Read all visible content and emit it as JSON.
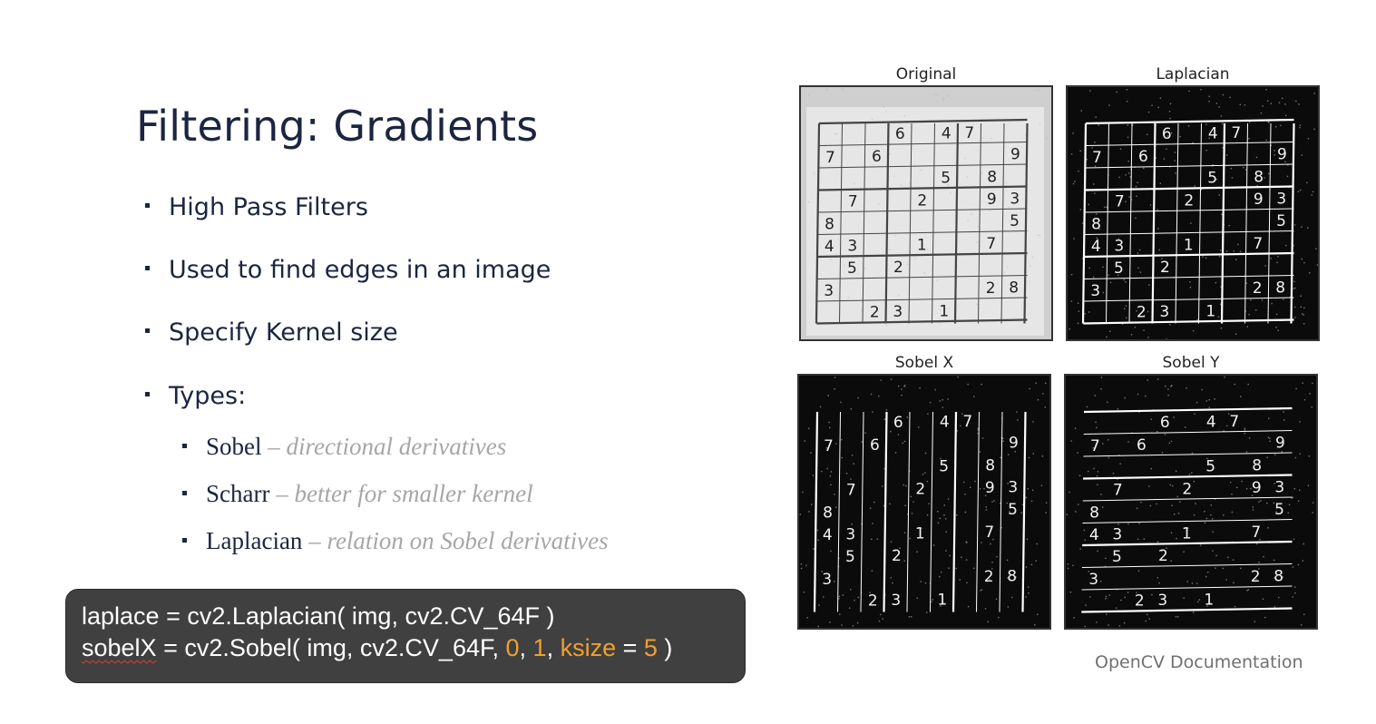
{
  "slide": {
    "title": "Filtering: Gradients",
    "bullets": [
      "High Pass Filters",
      "Used to find edges in an image",
      "Specify Kernel size",
      "Types:"
    ],
    "sub_bullets": [
      {
        "name": "Sobel",
        "dash": " – ",
        "desc": "directional derivatives"
      },
      {
        "name": "Scharr",
        "dash": " – ",
        "desc": "better for smaller kernel"
      },
      {
        "name": "Laplacian",
        "dash": " – ",
        "desc": "relation on Sobel derivatives"
      }
    ],
    "code": {
      "line1": "laplace = cv2.Laplacian( img,  cv2.CV_64F )",
      "line2_var": "sobelX",
      "line2_mid": " = cv2.Sobel( img, cv2.CV_64F, ",
      "line2_n0": "0",
      "line2_c1": ", ",
      "line2_n1": "1",
      "line2_c2": ", ",
      "line2_kw": "ksize",
      "line2_eq": " = ",
      "line2_n5": "5",
      "line2_end": " )",
      "number_color": "#f0a030"
    },
    "figure": {
      "panels": [
        "Original",
        "Laplacian",
        "Sobel X",
        "Sobel Y"
      ]
    },
    "credit": "OpenCV Documentation"
  },
  "sudoku": {
    "rows": [
      [
        "",
        "",
        "",
        "6",
        "",
        "4",
        "7",
        "",
        ""
      ],
      [
        "7",
        "",
        "6",
        "",
        "",
        "",
        "",
        "",
        "9"
      ],
      [
        "",
        "",
        "",
        "",
        "",
        "5",
        "",
        "8",
        ""
      ],
      [
        "",
        "7",
        "",
        "",
        "2",
        "",
        "",
        "9",
        "3"
      ],
      [
        "8",
        "",
        "",
        "",
        "",
        "",
        "",
        "",
        "5"
      ],
      [
        "4",
        "3",
        "",
        "",
        "1",
        "",
        "",
        "7",
        ""
      ],
      [
        "",
        "5",
        "",
        "2",
        "",
        "",
        "",
        "",
        ""
      ],
      [
        "3",
        "",
        "",
        "",
        "",
        "",
        "",
        "2",
        "8"
      ],
      [
        "",
        "",
        "2",
        "3",
        "",
        "1",
        "",
        "",
        ""
      ]
    ]
  }
}
